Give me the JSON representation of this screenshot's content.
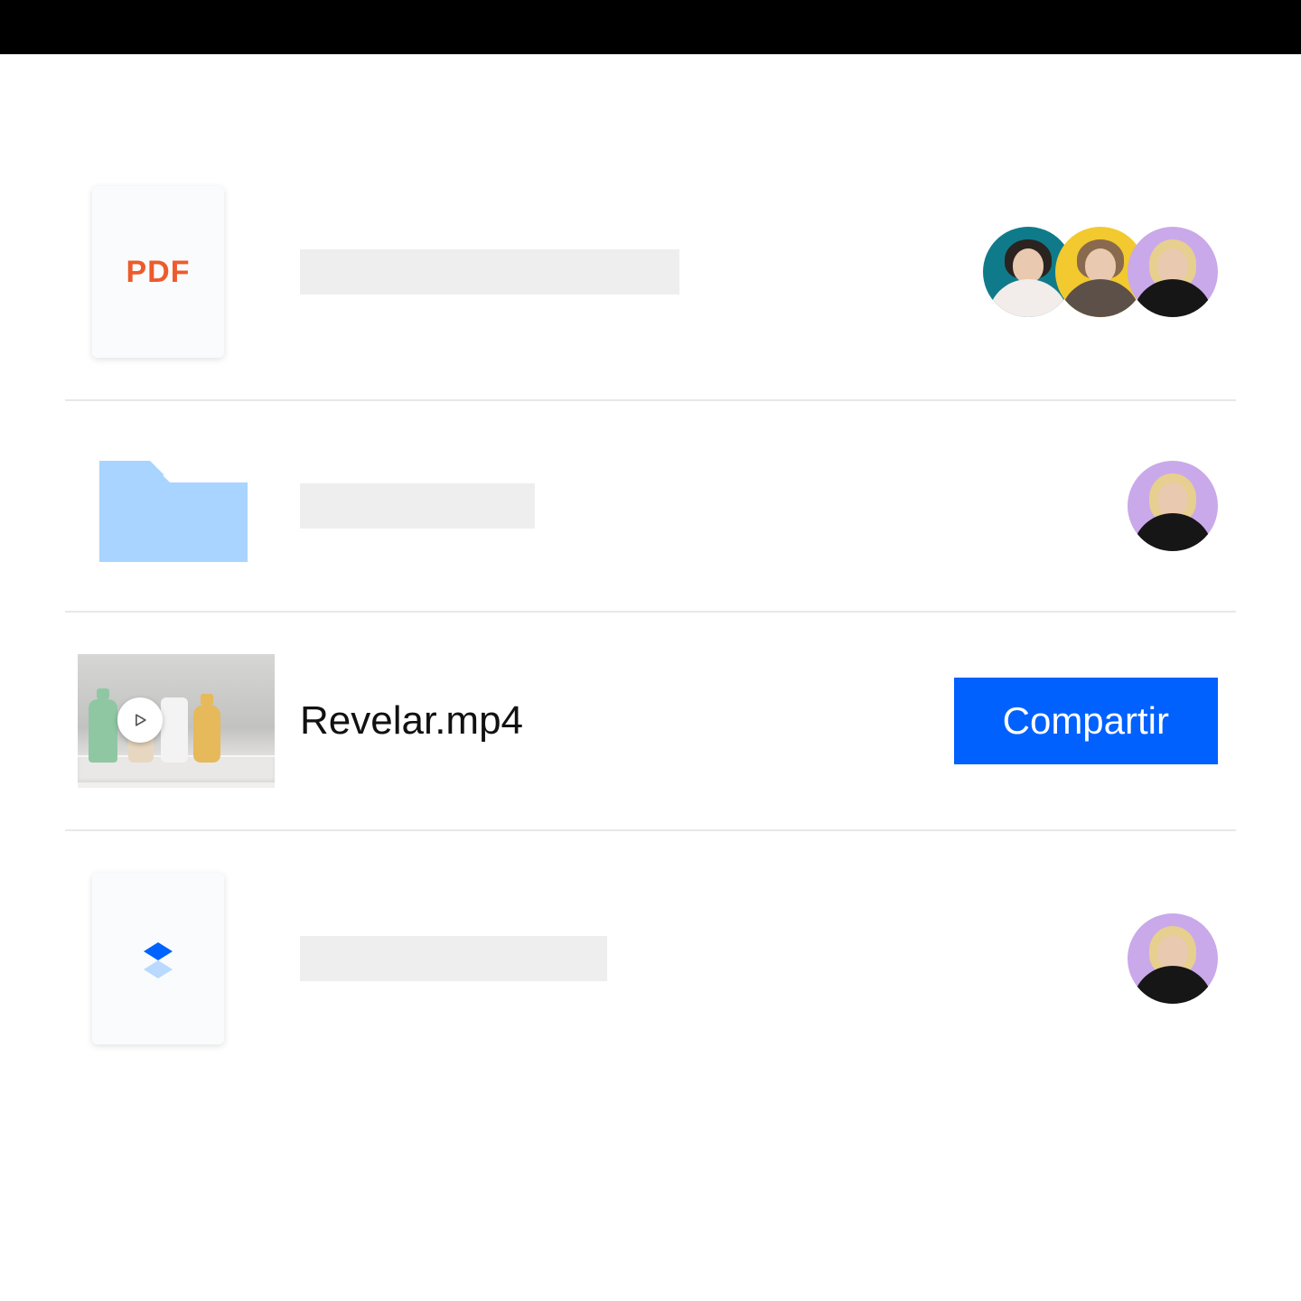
{
  "files": {
    "pdf_label": "PDF",
    "video_name": "Revelar.mp4"
  },
  "actions": {
    "share": "Compartir"
  },
  "avatars": {
    "colors": {
      "teal": "#0f7b8a",
      "yellow": "#f2c92e",
      "lilac": "#c9a9e9"
    }
  },
  "brand": {
    "primary": "#0061fe"
  }
}
